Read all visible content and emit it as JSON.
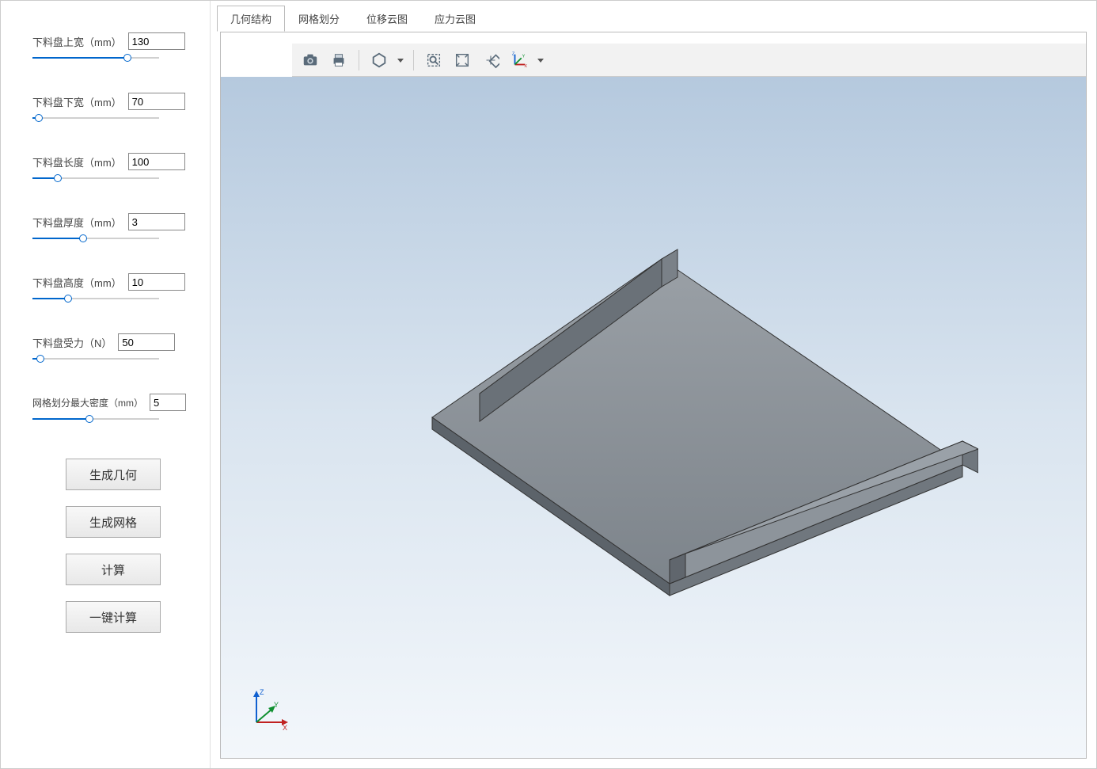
{
  "params": [
    {
      "label": "下料盘上宽（mm）",
      "value": "130",
      "pct": 75
    },
    {
      "label": "下料盘下宽（mm）",
      "value": "70",
      "pct": 5
    },
    {
      "label": "下料盘长度（mm）",
      "value": "100",
      "pct": 20
    },
    {
      "label": "下料盘厚度（mm）",
      "value": "3",
      "pct": 40
    },
    {
      "label": "下料盘高度（mm）",
      "value": "10",
      "pct": 28
    },
    {
      "label": "下料盘受力（N）",
      "value": "50",
      "pct": 6
    }
  ],
  "mesh": {
    "label": "网格划分最大密度（mm）",
    "value": "5",
    "pct": 45
  },
  "buttons": {
    "gen_geom": "生成几何",
    "gen_mesh": "生成网格",
    "compute": "计算",
    "one_click": "一键计算"
  },
  "tabs": [
    {
      "label": "几何结构",
      "active": true
    },
    {
      "label": "网格划分",
      "active": false
    },
    {
      "label": "位移云图",
      "active": false
    },
    {
      "label": "应力云图",
      "active": false
    }
  ],
  "axes": {
    "x": "X",
    "y": "Y",
    "z": "Z"
  }
}
